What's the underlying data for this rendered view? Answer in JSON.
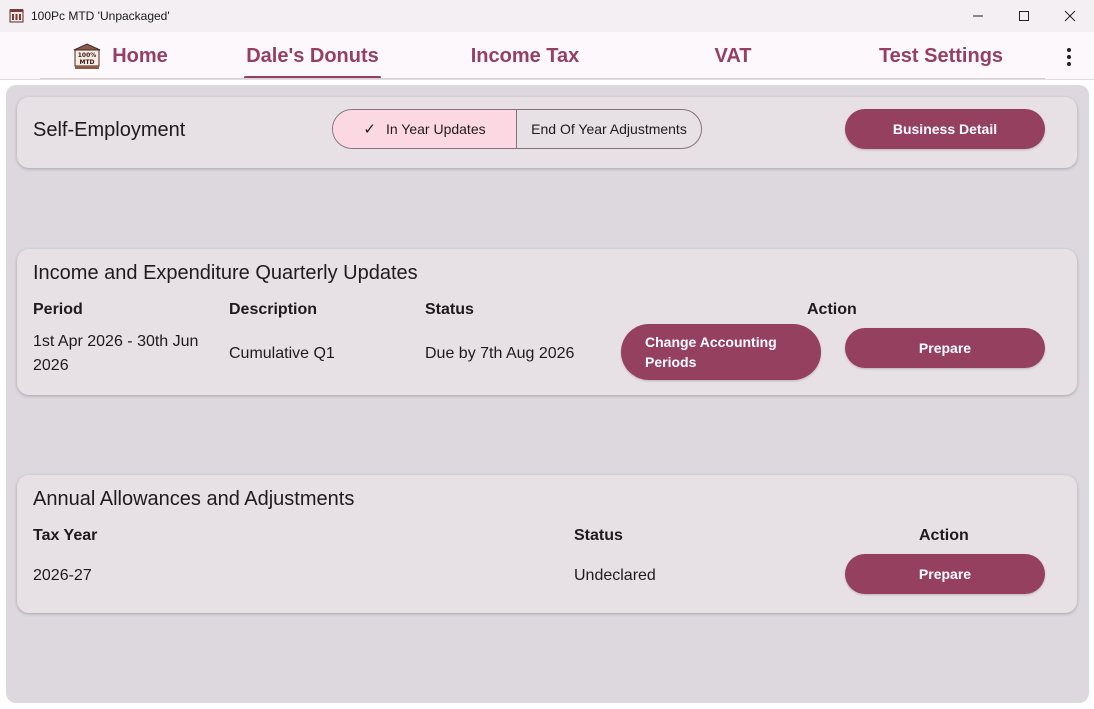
{
  "window": {
    "title": "100Pc MTD 'Unpackaged'"
  },
  "nav": {
    "tabs": [
      {
        "label": "Home"
      },
      {
        "label": "Dale's Donuts"
      },
      {
        "label": "Income Tax"
      },
      {
        "label": "VAT"
      },
      {
        "label": "Test Settings"
      }
    ],
    "active_tab": "Dale's Donuts"
  },
  "self_employment": {
    "title": "Self-Employment",
    "segments": [
      "In Year Updates",
      "End Of Year Adjustments"
    ],
    "selected_segment": "In Year Updates",
    "business_detail_label": "Business Detail"
  },
  "quarterly": {
    "title": "Income and Expenditure Quarterly Updates",
    "headers": {
      "period": "Period",
      "description": "Description",
      "status": "Status",
      "action": "Action"
    },
    "row": {
      "period": "1st Apr 2026 - 30th Jun 2026",
      "description": "Cumulative Q1",
      "status": "Due by 7th Aug 2026",
      "change_label": "Change Accounting Periods",
      "prepare_label": "Prepare"
    }
  },
  "annual": {
    "title": "Annual Allowances and Adjustments",
    "headers": {
      "tax_year": "Tax Year",
      "status": "Status",
      "action": "Action"
    },
    "row": {
      "tax_year": "2026-27",
      "status": "Undeclared",
      "prepare_label": "Prepare"
    }
  },
  "colors": {
    "accent": "#96405f",
    "selected_segment_bg": "#fcd9e2",
    "card_bg": "#e7e1e6",
    "content_bg": "#ddd8dd"
  },
  "icons": {
    "app": "bank-building-icon",
    "check": "check-icon",
    "more": "more-vert-icon"
  }
}
